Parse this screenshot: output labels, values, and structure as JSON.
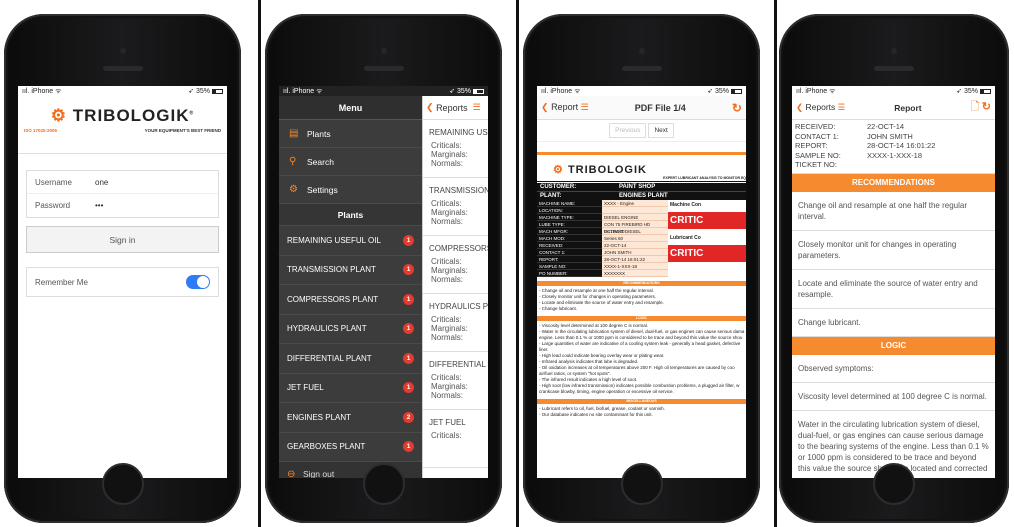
{
  "status": {
    "carrier": "iPhone",
    "battery": "35%"
  },
  "login": {
    "brand": "TRIBOLOGIK",
    "iso": "ISO 17025:2005",
    "tagline": "YOUR EQUIPMENT'S BEST FRIEND",
    "username_label": "Username",
    "username_value": "one",
    "password_label": "Password",
    "password_value": "•••",
    "signin_label": "Sign in",
    "remember_label": "Remember Me"
  },
  "menu": {
    "title": "Menu",
    "items": [
      {
        "label": "Plants",
        "icon": "clipboard-icon"
      },
      {
        "label": "Search",
        "icon": "search-icon"
      },
      {
        "label": "Settings",
        "icon": "gear-icon"
      }
    ],
    "plants_title": "Plants",
    "plants": [
      {
        "label": "REMAINING USEFUL OIL",
        "badge": "1"
      },
      {
        "label": "TRANSMISSION PLANT",
        "badge": "1"
      },
      {
        "label": "COMPRESSORS PLANT",
        "badge": "1"
      },
      {
        "label": "HYDRAULICS PLANT",
        "badge": "1"
      },
      {
        "label": "DIFFERENTIAL PLANT",
        "badge": "1"
      },
      {
        "label": "JET FUEL",
        "badge": "1"
      },
      {
        "label": "ENGINES PLANT",
        "badge": "2"
      },
      {
        "label": "GEARBOXES PLANT",
        "badge": "1"
      }
    ],
    "signout": "Sign out"
  },
  "reports": {
    "title": "Reports",
    "cards": [
      {
        "title": "REMAINING USEF",
        "rows": [
          "Criticals:",
          "Marginals:",
          "Normals:"
        ]
      },
      {
        "title": "TRANSMISSION P",
        "rows": [
          "Criticals:",
          "Marginals:",
          "Normals:"
        ]
      },
      {
        "title": "COMPRESSORS P",
        "rows": [
          "Criticals:",
          "Marginals:",
          "Normals:"
        ]
      },
      {
        "title": "HYDRAULICS PLA",
        "rows": [
          "Criticals:",
          "Marginals:",
          "Normals:"
        ]
      },
      {
        "title": "DIFFERENTIAL PL",
        "rows": [
          "Criticals:",
          "Marginals:",
          "Normals:"
        ]
      },
      {
        "title": "JET FUEL",
        "rows": [
          "Criticals:"
        ]
      }
    ]
  },
  "pdf": {
    "back": "Report",
    "title": "PDF File 1/4",
    "prev": "Previous",
    "next": "Next",
    "subtitle": "EXPERT LUBRICANT ANALYSIS TO MONITOR EQ",
    "customer_label": "CUSTOMER:",
    "customer": "PAINT SHOP",
    "plant_label": "PLANT:",
    "plant": "ENGINES PLANT",
    "fields": [
      {
        "k": "MACHINE NAME:",
        "v": "XXXX - Engine"
      },
      {
        "k": "LOCATION:",
        "v": ""
      },
      {
        "k": "MACHINE TYPE:",
        "v": "DIESEL ENGINE"
      },
      {
        "k": "LUBE TYPE:",
        "v": "CON 75 FIREBIRD HD EC10W40"
      },
      {
        "k": "MACH MFGR:",
        "v": "DETROIT DIESEL"
      },
      {
        "k": "MACH MOD:",
        "v": "Series 60"
      },
      {
        "k": "RECEIVED:",
        "v": "22-OCT-14"
      },
      {
        "k": "CONTACT 1:",
        "v": "JOHN SMITH"
      },
      {
        "k": "REPORT:",
        "v": "28-OCT-14 16:01:22"
      },
      {
        "k": "SAMPLE NO:",
        "v": "XXXX-1-XXX-18"
      },
      {
        "k": "PO NUMBER:",
        "v": "XXXXXXX"
      }
    ],
    "machine_cond": "Machine Con",
    "lubricant_cond": "Lubricant Co",
    "critical": "CRITIC",
    "recommendations_title": "RECOMMENDATIONS",
    "rec_lines": [
      "- Change oil and resample at one half the regular interval.",
      "- Closely monitor unit for changes in operating parameters.",
      "- Locate and eliminate the source of water entry and resample.",
      "- Change lubricant."
    ],
    "logic_title": "LOGIC",
    "logic_lines": [
      "- Viscosity level determined at 100 degree C is normal.",
      "- Water in the circulating lubrication system of diesel, dual-fuel, or gas engines can cause serious dama",
      "  engine. Less than 0.1 % or 1000 ppm is considered to be trace and beyond this value the source shou",
      "- Large quantities of water are indicative of a cooling system leak - generally a head gasket, defective",
      "  liner.",
      "- High lead could indicate bearing overlay wear or plating wear.",
      "- Infrared analysis indicates that lube is degraded.",
      "- Oil oxidation increases at oil temperatures above 200 F. High oil temperatures are caused by coo",
      "  air/fuel ratios, or system \"hot spots\".",
      "- The infrared result indicates a high level of soot.",
      "- High soot (low infrared transmission) indicates possible combustion problems, a plugged air filter, w",
      "  crankcase blowby, timing, engine operation or excessive oil service."
    ],
    "misc_title": "MISCELLANEOUS",
    "misc_lines": [
      "- Lubricant refers to oil, fuel, biofuel, grease, coolant or varnish.",
      "- Our database indicates no site contaminant for this unit."
    ]
  },
  "report": {
    "back": "Reports",
    "title": "Report",
    "fields": [
      {
        "k": "RECEIVED:",
        "v": "22-OCT-14"
      },
      {
        "k": "CONTACT 1:",
        "v": "JOHN SMITH"
      },
      {
        "k": "REPORT:",
        "v": "28-OCT-14 16:01:22"
      },
      {
        "k": "SAMPLE NO:",
        "v": "XXXX-1-XXX-18"
      },
      {
        "k": "TICKET NO:",
        "v": ""
      }
    ],
    "recommendations_title": "RECOMMENDATIONS",
    "recommendations": [
      "Change oil and resample at one half the regular interval.",
      "Closely monitor unit for changes in operating parameters.",
      "Locate and eliminate the source of water entry and resample.",
      "Change lubricant."
    ],
    "logic_title": "LOGIC",
    "logic": [
      "Observed symptoms:",
      "Viscosity level determined at 100 degree C is normal.",
      "Water in the circulating lubrication system of diesel, dual-fuel, or gas engines can cause serious damage to the bearing systems of the engine. Less than 0.1 % or 1000 ppm is considered to be trace and beyond this value the source should be located and corrected"
    ]
  },
  "colors": {
    "accent": "#f26c1a",
    "critical": "#e12626",
    "toggle": "#2d7cf6",
    "menu_bg": "#3c3c3c"
  }
}
